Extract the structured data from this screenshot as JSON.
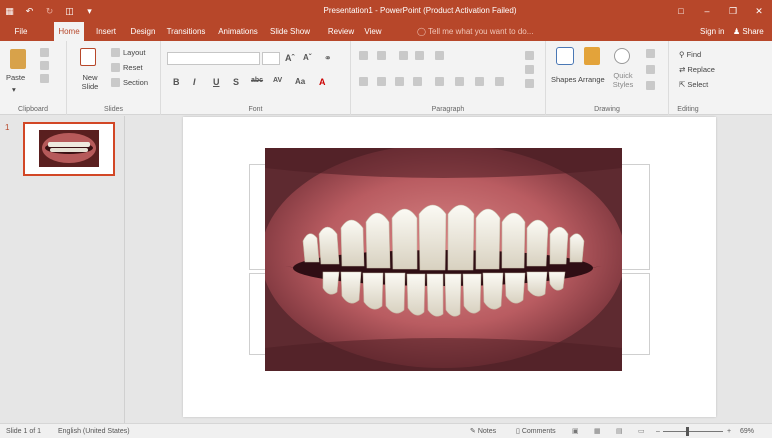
{
  "window": {
    "title": "Presentation1 - PowerPoint (Product Activation Failed)",
    "controls": [
      "□",
      "–",
      "❒",
      "✕"
    ]
  },
  "qat": {
    "icons": [
      "save-icon",
      "undo-icon",
      "redo-icon",
      "start-from-beginning-icon",
      "customize-qat-icon"
    ]
  },
  "tabs": [
    {
      "label": "File"
    },
    {
      "label": "Home"
    },
    {
      "label": "Insert"
    },
    {
      "label": "Design"
    },
    {
      "label": "Transitions"
    },
    {
      "label": "Animations"
    },
    {
      "label": "Slide Show"
    },
    {
      "label": "Review"
    },
    {
      "label": "View"
    }
  ],
  "tell_me": "Tell me what you want to do...",
  "sign_in": "Sign in",
  "share": "Share",
  "ribbon": {
    "clipboard": {
      "label": "Clipboard",
      "paste": "Paste"
    },
    "slides": {
      "label": "Slides",
      "new_slide": "New Slide",
      "layout": "Layout",
      "reset": "Reset",
      "section": "Section"
    },
    "font": {
      "label": "Font",
      "font_name": "",
      "font_size": ""
    },
    "paragraph": {
      "label": "Paragraph"
    },
    "drawing": {
      "label": "Drawing",
      "shapes": "Shapes",
      "arrange": "Arrange",
      "quick_styles": "Quick Styles"
    },
    "editing": {
      "label": "Editing",
      "find": "Find",
      "replace": "Replace",
      "select": "Select"
    }
  },
  "slides_pane": {
    "slide_number": "1"
  },
  "status": {
    "slide_info": "Slide 1 of 1",
    "language": "English (United States)",
    "notes": "Notes",
    "comments": "Comments",
    "zoom": "69%"
  },
  "colors": {
    "accent": "#b7472a",
    "ribbon_bg": "#f3f3f3",
    "canvas_bg": "#e6e6e6"
  }
}
